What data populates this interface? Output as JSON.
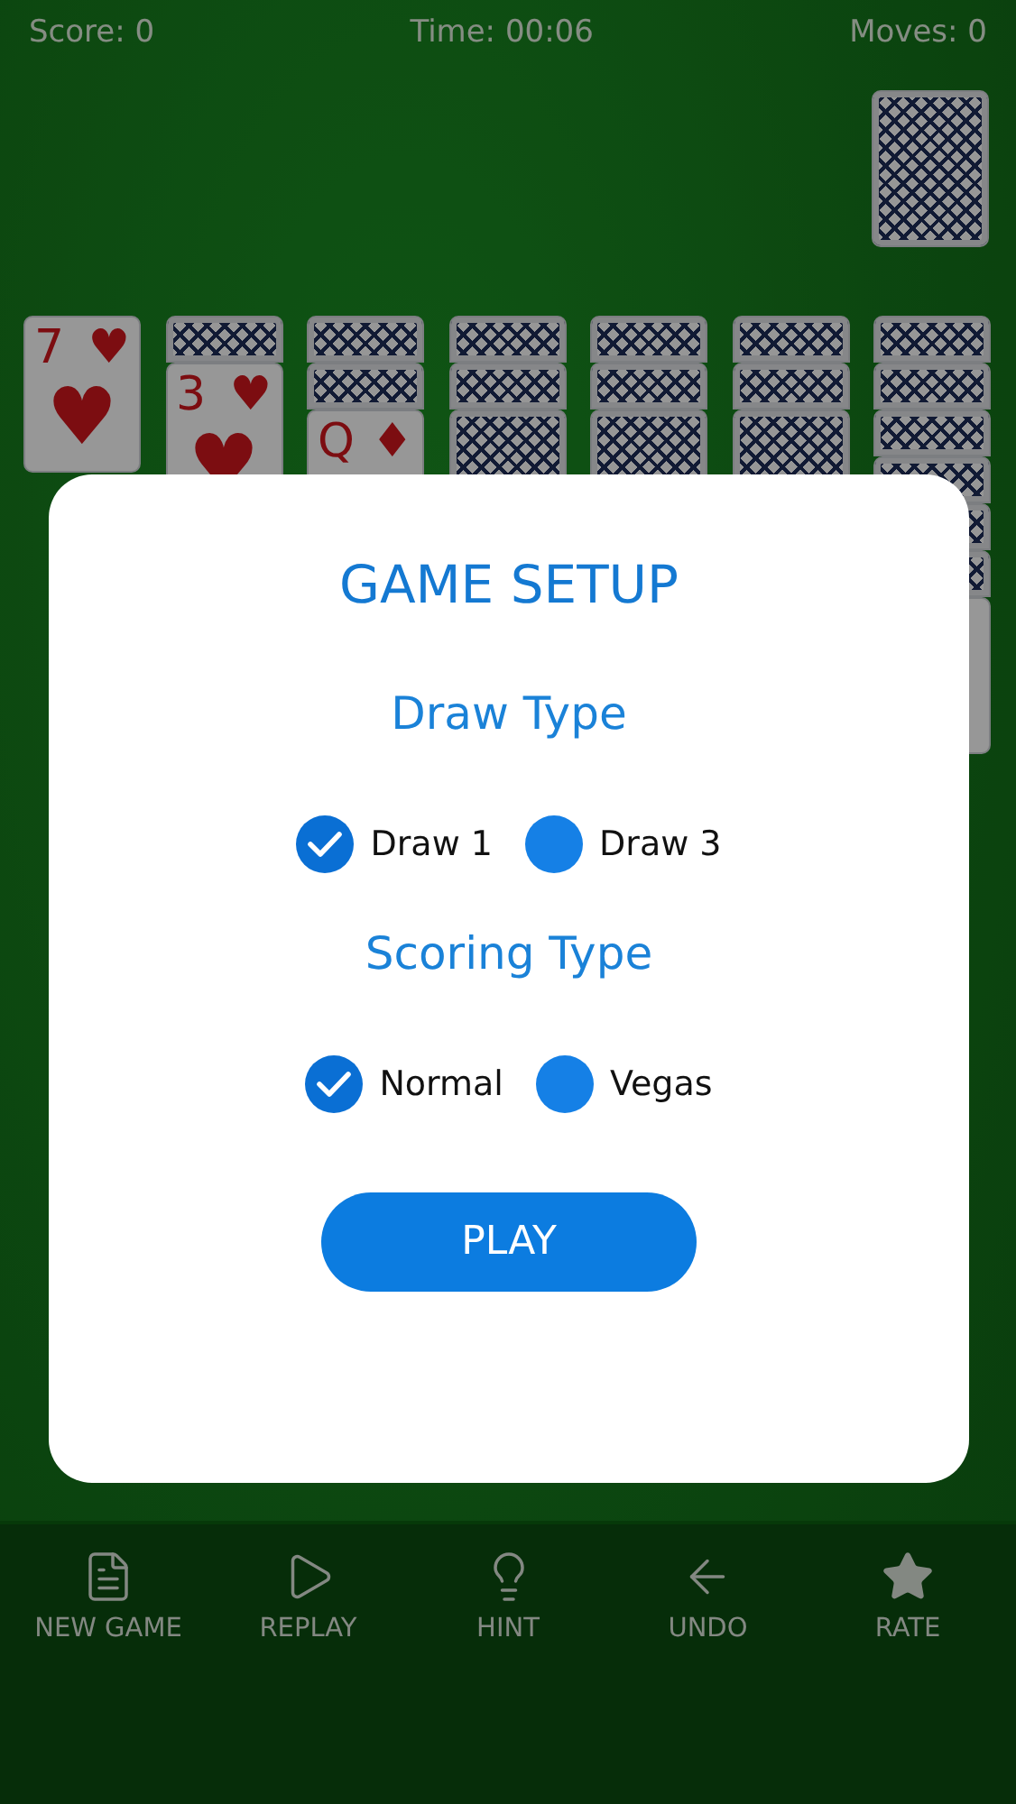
{
  "status_bar": {
    "score": "Score: 0",
    "time": "Time: 00:06",
    "moves": "Moves: 0"
  },
  "stock": {
    "kind": "down"
  },
  "tableau": [
    {
      "cards": [
        {
          "kind": "up",
          "rank": "7",
          "suit": "♥"
        }
      ]
    },
    {
      "cards": [
        {
          "kind": "down"
        },
        {
          "kind": "up",
          "rank": "3",
          "suit": "♥"
        }
      ]
    },
    {
      "cards": [
        {
          "kind": "down"
        },
        {
          "kind": "down"
        },
        {
          "kind": "up",
          "rank": "Q",
          "suit": "♦"
        }
      ]
    },
    {
      "cards": [
        {
          "kind": "down"
        },
        {
          "kind": "down"
        },
        {
          "kind": "down"
        }
      ]
    },
    {
      "cards": [
        {
          "kind": "down"
        },
        {
          "kind": "down"
        },
        {
          "kind": "down"
        }
      ]
    },
    {
      "cards": [
        {
          "kind": "down"
        },
        {
          "kind": "down"
        },
        {
          "kind": "down"
        }
      ]
    },
    {
      "cards": [
        {
          "kind": "down"
        },
        {
          "kind": "down"
        },
        {
          "kind": "down"
        },
        {
          "kind": "down"
        },
        {
          "kind": "down"
        },
        {
          "kind": "down"
        },
        {
          "kind": "up"
        }
      ]
    }
  ],
  "dialog": {
    "title": "GAME SETUP",
    "sections": [
      {
        "heading": "Draw Type",
        "options": [
          {
            "label": "Draw 1",
            "selected": true
          },
          {
            "label": "Draw 3",
            "selected": false
          }
        ]
      },
      {
        "heading": "Scoring Type",
        "options": [
          {
            "label": "Normal",
            "selected": true
          },
          {
            "label": "Vegas",
            "selected": false
          }
        ]
      }
    ],
    "button": "PLAY"
  },
  "toolbar": [
    {
      "kind": "new",
      "label": "NEW GAME"
    },
    {
      "kind": "replay",
      "label": "REPLAY"
    },
    {
      "kind": "hint",
      "label": "HINT"
    },
    {
      "kind": "undo",
      "label": "UNDO"
    },
    {
      "kind": "rate",
      "label": "RATE"
    }
  ]
}
